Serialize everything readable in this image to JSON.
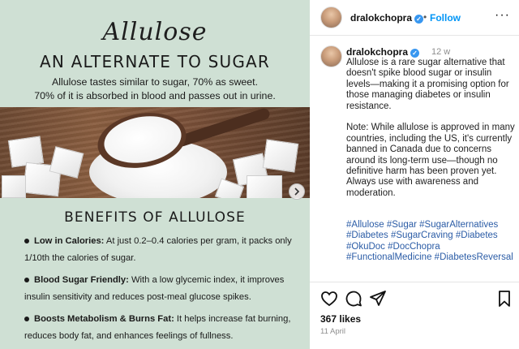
{
  "post_image": {
    "script_title": "Allulose",
    "headline": "AN ALTERNATE TO SUGAR",
    "subtitle_line1": "Allulose tastes similar to sugar, 70% as sweet.",
    "subtitle_line2": "70% of it is absorbed in blood and passes out in urine.",
    "benefits_title": "BENEFITS OF ALLULOSE",
    "benefits": [
      {
        "label": "Low in Calories:",
        "line1": " At just 0.2–0.4 calories per gram, it packs only",
        "line2": "1/10th the calories of sugar."
      },
      {
        "label": "Blood Sugar Friendly:",
        "line1": " With a low glycemic index, it improves",
        "line2": "insulin sensitivity and reduces post-meal glucose spikes."
      },
      {
        "label": "Boosts Metabolism & Burns Fat:",
        "line1": " It helps increase fat burning,",
        "line2": "reduces body fat, and enhances feelings of fullness."
      }
    ],
    "next_icon": "chevron-right-icon"
  },
  "header": {
    "username": "dralokchopra",
    "separator": "•",
    "follow_label": "Follow",
    "more_label": "···"
  },
  "caption": {
    "username": "dralokchopra",
    "time": "12 w",
    "text": "Allulose is a rare sugar alternative that doesn't spike blood sugar or insulin levels—making it a promising option for those managing diabetes or insulin resistance.\n\nNote: While allulose is approved in many countries, including the US, it's currently banned in Canada due to concerns around its long-term use—though no definitive harm has been proven yet. Always use with awareness and moderation.",
    "hashtags": "#Allulose #Sugar #SugarAlternatives #Diabetes #SugarCraving #Diabetes #OkuDoc #DocChopra #FunctionalMedicine #DiabetesReversal"
  },
  "actions": {
    "icons": [
      "heart-icon",
      "comment-icon",
      "share-icon",
      "bookmark-icon"
    ]
  },
  "likes": "367 likes",
  "date": "11 April",
  "colors": {
    "panel_bg": "#cfe0d4",
    "link_blue": "#0095f6",
    "hashtag_blue": "#2b5ca6",
    "verified_blue": "#3897f0"
  }
}
